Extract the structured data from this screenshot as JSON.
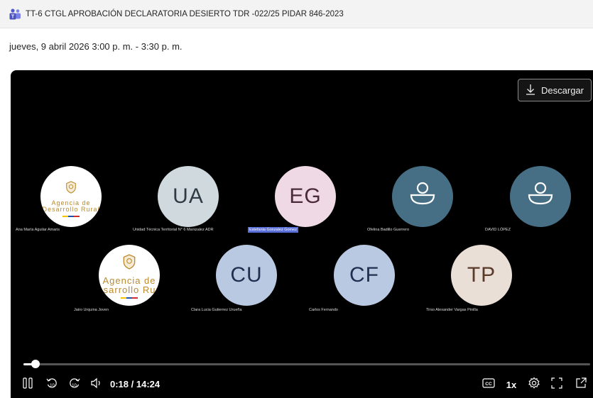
{
  "header": {
    "title": "TT-6 CTGL APROBACIÓN DECLARATORIA DESIERTO TDR -022/25 PIDAR 846-2023",
    "datetime": "jueves, 9 abril 2026 3:00 p. m. - 3:30 p. m."
  },
  "player": {
    "download_label": "Descargar",
    "time": "0:18 / 14:24",
    "progress_fraction": 0.021,
    "speed_label": "1x",
    "participants": [
      {
        "kind": "logo",
        "logo_text": [
          "Agencia de",
          "Desarrollo Rural"
        ],
        "name": "Ana María Aguilar Amaris"
      },
      {
        "kind": "initials",
        "initials": "UA",
        "bg": "#cfd9de",
        "fg": "#2f3b44",
        "name": "Unidad Técnica Territorial N° 6 Manizalez ADR"
      },
      {
        "kind": "initials",
        "initials": "EG",
        "bg": "#efd9e4",
        "fg": "#4a2a3a",
        "name": "Estefania Gonzalez Gomez",
        "highlight": true
      },
      {
        "kind": "person",
        "bg": "#466f86",
        "name": "Ofelina Badillo Guerrero"
      },
      {
        "kind": "person",
        "bg": "#466f86",
        "name": "DAVID LÓPEZ"
      },
      {
        "kind": "logo",
        "logo_text": [
          "Agencia de",
          "Desarrollo Rural"
        ],
        "name": "Jairo Urquina Joven"
      },
      {
        "kind": "initials",
        "initials": "CU",
        "bg": "#b9c9e2",
        "fg": "#1f2f4f",
        "name": "Clara Lucia Gutierrez Urueña"
      },
      {
        "kind": "initials",
        "initials": "CF",
        "bg": "#b9c9e2",
        "fg": "#1f2f4f",
        "name": "Carlos Fernando"
      },
      {
        "kind": "initials",
        "initials": "TP",
        "bg": "#eadfd7",
        "fg": "#5a3a2a",
        "name": "Tirso Alexander Vargas Pinilla"
      }
    ]
  }
}
